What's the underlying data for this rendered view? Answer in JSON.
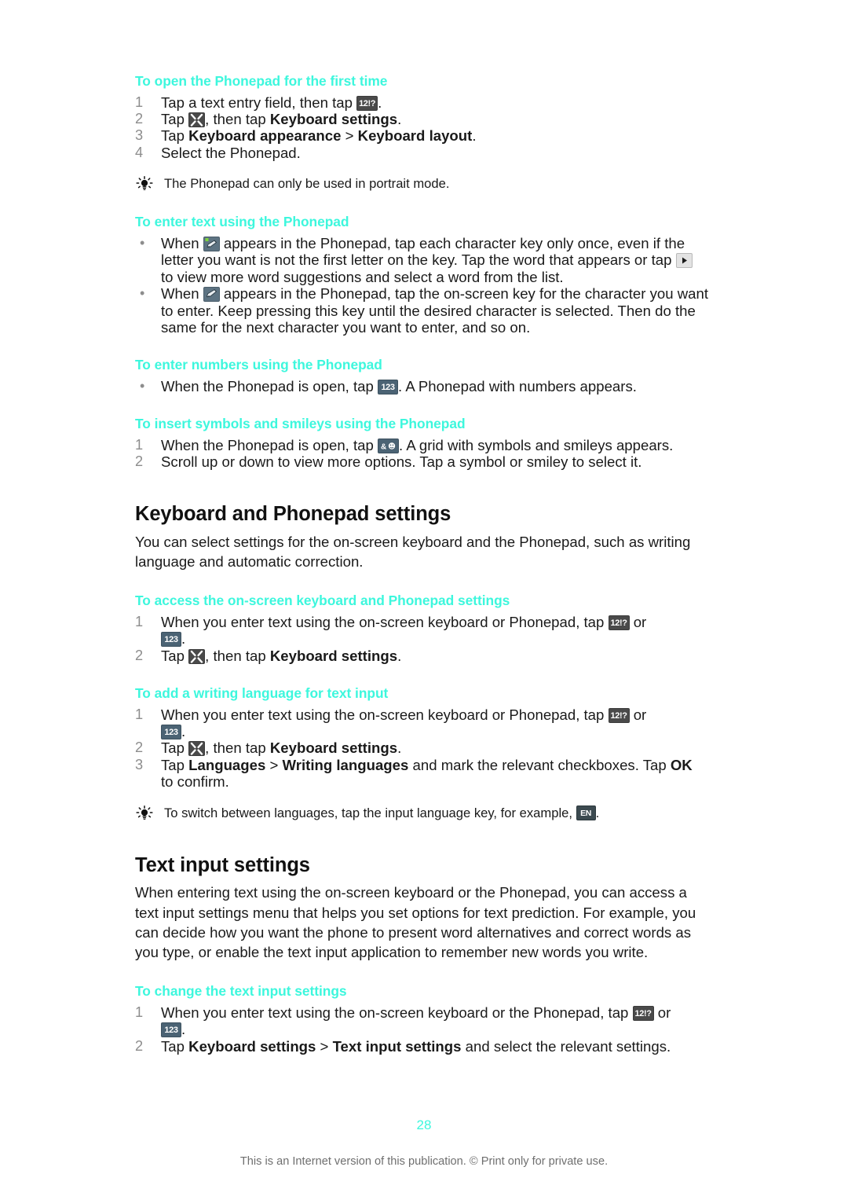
{
  "document": {
    "page_number": "28",
    "footer_note": "This is an Internet version of this publication. © Print only for private use.",
    "accent_color": "#3DF7DD"
  },
  "procedures": {
    "open_phonepad": {
      "title": "To open the Phonepad for the first time",
      "steps": [
        {
          "num": "1",
          "pre": "Tap a text entry field, then tap ",
          "key": "12!?",
          "post": "."
        },
        {
          "num": "2",
          "pre": "Tap ",
          "key": "tools",
          "mid": ", then tap ",
          "bold": "Keyboard settings",
          "post": "."
        },
        {
          "num": "3",
          "pre": "Tap ",
          "bold1": "Keyboard appearance",
          "mid": " > ",
          "bold2": "Keyboard layout",
          "post": "."
        },
        {
          "num": "4",
          "pre": "Select the Phonepad.",
          "post": ""
        }
      ],
      "tip": "The Phonepad can only be used in portrait mode."
    },
    "enter_text": {
      "title": "To enter text using the Phonepad",
      "bullets": [
        {
          "p1": "When ",
          "key1": "pen-dot",
          "p2": " appears in the Phonepad, tap each character key only once, even if the letter you want is not the first letter on the key. Tap the word that appears or tap ",
          "key2": "arrow",
          "p3": " to view more word suggestions and select a word from the list."
        },
        {
          "p1": "When ",
          "key1": "pen",
          "p2": " appears in the Phonepad, tap the on-screen key for the character you want to enter. Keep pressing this key until the desired character is selected. Then do the same for the next character you want to enter, and so on."
        }
      ]
    },
    "enter_numbers": {
      "title": "To enter numbers using the Phonepad",
      "bullets": [
        {
          "p1": "When the Phonepad is open, tap ",
          "key1": "123",
          "p2": ". A Phonepad with numbers appears."
        }
      ]
    },
    "insert_symbols": {
      "title": "To insert symbols and smileys using the Phonepad",
      "steps": [
        {
          "num": "1",
          "pre": "When the Phonepad is open, tap ",
          "key": "&smiley",
          "post": ". A grid with symbols and smileys appears."
        },
        {
          "num": "2",
          "pre": "Scroll up or down to view more options. Tap a symbol or smiley to select it.",
          "post": ""
        }
      ]
    },
    "access_settings": {
      "title": "To access the on-screen keyboard and Phonepad settings",
      "steps": [
        {
          "num": "1",
          "pre": "When you enter text using the on-screen keyboard or Phonepad, tap ",
          "key": "12!?",
          "mid": " or ",
          "key2": "123",
          "post": "."
        },
        {
          "num": "2",
          "pre": "Tap ",
          "key": "tools",
          "mid": ", then tap ",
          "bold": "Keyboard settings",
          "post": "."
        }
      ]
    },
    "add_language": {
      "title": "To add a writing language for text input",
      "steps": [
        {
          "num": "1",
          "pre": "When you enter text using the on-screen keyboard or Phonepad, tap ",
          "key": "12!?",
          "mid": " or ",
          "key2": "123",
          "post": "."
        },
        {
          "num": "2",
          "pre": "Tap ",
          "key": "tools",
          "mid": ", then tap ",
          "bold": "Keyboard settings",
          "post": "."
        },
        {
          "num": "3",
          "pre": "Tap ",
          "bold1": "Languages",
          "mid": " > ",
          "bold2": "Writing languages",
          "mid2": " and mark the relevant checkboxes. Tap ",
          "bold3": "OK",
          "post": " to confirm."
        }
      ],
      "tip_pre": "To switch between languages, tap the input language key, for example, ",
      "tip_key": "EN",
      "tip_post": "."
    },
    "change_text_input": {
      "title": "To change the text input settings",
      "steps": [
        {
          "num": "1",
          "pre": "When you enter text using the on-screen keyboard or the Phonepad, tap ",
          "key": "12!?",
          "mid": " or ",
          "key2": "123",
          "post": "."
        },
        {
          "num": "2",
          "pre": "Tap ",
          "bold1": "Keyboard settings",
          "mid": " > ",
          "bold2": "Text input settings",
          "post": " and select the relevant settings."
        }
      ]
    }
  },
  "sections": {
    "keyboard_phonepad_settings": {
      "heading": "Keyboard and Phonepad settings",
      "intro": "You can select settings for the on-screen keyboard and the Phonepad, such as writing language and automatic correction."
    },
    "text_input_settings": {
      "heading": "Text input settings",
      "intro": "When entering text using the on-screen keyboard or the Phonepad, you can access a text input settings menu that helps you set options for text prediction. For example, you can decide how you want the phone to present word alternatives and correct words as you type, or enable the text input application to remember new words you write."
    }
  },
  "keys": {
    "k12": "12!?",
    "k123": "123",
    "ksym": "&",
    "ken": "EN"
  }
}
